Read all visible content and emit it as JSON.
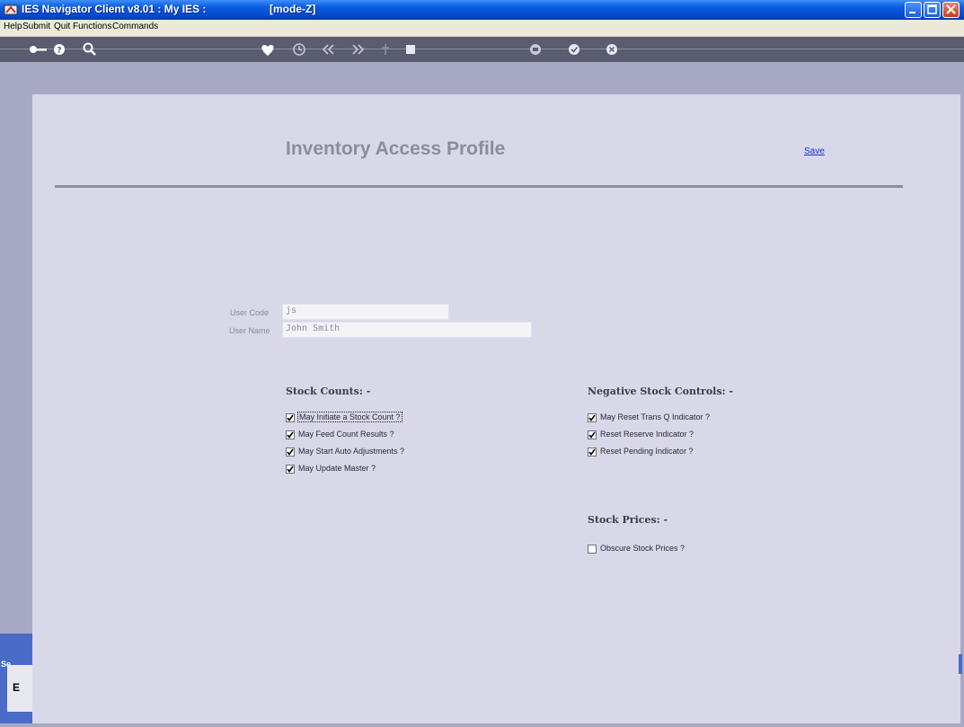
{
  "window": {
    "title": "IES Navigator Client v8.01 : My IES :",
    "mode": "[mode-Z]"
  },
  "menu": [
    "Help",
    "Submit",
    "Quit",
    "Functions",
    "Commands"
  ],
  "toolbar_icons": [
    "key-icon",
    "help-icon",
    "search-icon",
    "heart-icon",
    "clock-icon",
    "back-icon",
    "forward-icon",
    "pin-icon",
    "stop-icon",
    "print-icon",
    "ok-icon",
    "close-icon"
  ],
  "page": {
    "title": "Inventory Access Profile",
    "save_label": "Save"
  },
  "user": {
    "code_label": "User Code",
    "code_value": "js",
    "name_label": "User Name",
    "name_value": "John Smith"
  },
  "stock_counts": {
    "heading": "Stock Counts: -",
    "items": [
      {
        "label": "May Initiate a Stock Count ?",
        "checked": true
      },
      {
        "label": "May Feed Count Results ?",
        "checked": true
      },
      {
        "label": "May Start Auto Adjustments ?",
        "checked": true
      },
      {
        "label": "May Update Master ?",
        "checked": true
      }
    ]
  },
  "negative_stock": {
    "heading": "Negative Stock Controls: -",
    "items": [
      {
        "label": "May Reset Trans Q Indicator ?",
        "checked": true
      },
      {
        "label": "Reset Reserve Indicator ?",
        "checked": true
      },
      {
        "label": "Reset Pending Indicator ?",
        "checked": true
      }
    ]
  },
  "stock_prices": {
    "heading": "Stock Prices: -",
    "items": [
      {
        "label": "Obscure Stock Prices ?",
        "checked": false
      }
    ]
  },
  "side": {
    "strip_label": "Se",
    "strip_glyph": "E"
  },
  "colors": {
    "titlebar": "#0a5de0",
    "panel": "#d8d8e8",
    "outer": "#a7a9c4",
    "toolbar": "#5a5c70",
    "link": "#1a33c8"
  }
}
